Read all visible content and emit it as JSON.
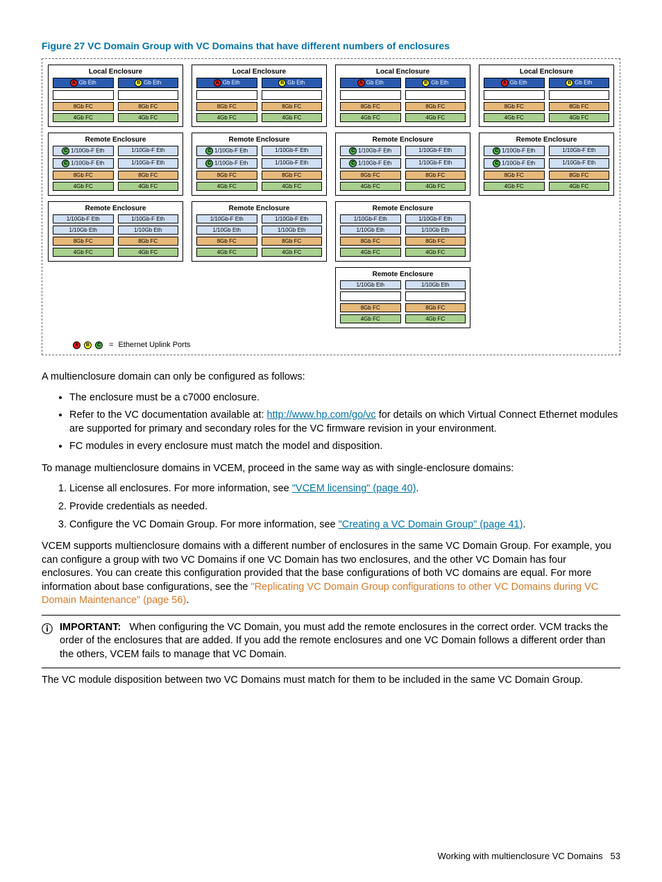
{
  "figure": {
    "caption": "Figure 27 VC Domain Group with VC Domains that have different numbers of enclosures",
    "enc_labels": {
      "local": "Local Enclosure",
      "remote": "Remote Enclosure"
    },
    "chips": {
      "gb_eth": "Gb Eth",
      "eth_110f": "1/10Gb-F Eth",
      "eth_110": "1/10Gb Eth",
      "fc8": "8Gb FC",
      "fc4": "4Gb FC"
    },
    "legend": {
      "eq": "=",
      "text": "Ethernet Uplink Ports"
    }
  },
  "text": {
    "intro": "A multienclosure domain can only be configured as follows:",
    "b1": "The enclosure must be a c7000 enclosure.",
    "b2a": "Refer to the VC documentation available at: ",
    "b2_link": "http://www.hp.com/go/vc",
    "b2b": " for details on which Virtual Connect Ethernet modules are supported for primary and secondary roles for the VC firmware revision in your environment.",
    "b3": "FC modules in every enclosure must match the model and disposition.",
    "manage": "To manage multienclosure domains in VCEM, proceed in the same way as with single-enclosure domains:",
    "n1a": "License all enclosures. For more information, see ",
    "n1_link": "\"VCEM licensing\" (page 40)",
    "n1b": ".",
    "n2": "Provide credentials as needed.",
    "n3a": "Configure the VC Domain Group. For more information, see ",
    "n3_link": "\"Creating a VC Domain Group\" (page 41)",
    "n3b": ".",
    "support_a": "VCEM supports multienclosure domains with a different number of enclosures in the same VC Domain Group. For example, you can configure a group with two VC Domains if one VC Domain has two enclosures, and the other VC Domain has four enclosures. You can create this configuration provided that the base configurations of both VC domains are equal. For more information about base configurations, see the ",
    "support_link": "\"Replicating VC Domain Group configurations to other VC Domains during VC Domain Maintenance\" (page 56)",
    "support_b": ".",
    "important_label": "IMPORTANT:",
    "important_body": "When configuring the VC Domain, you must add the remote enclosures in the correct order. VCM tracks the order of the enclosures that are added. If you add the remote enclosures and one VC Domain follows a different order than the others, VCEM fails to manage that VC Domain.",
    "disposition": "The VC module disposition between two VC Domains must match for them to be included in the same VC Domain Group."
  },
  "footer": {
    "title": "Working with multienclosure VC Domains",
    "page": "53"
  }
}
